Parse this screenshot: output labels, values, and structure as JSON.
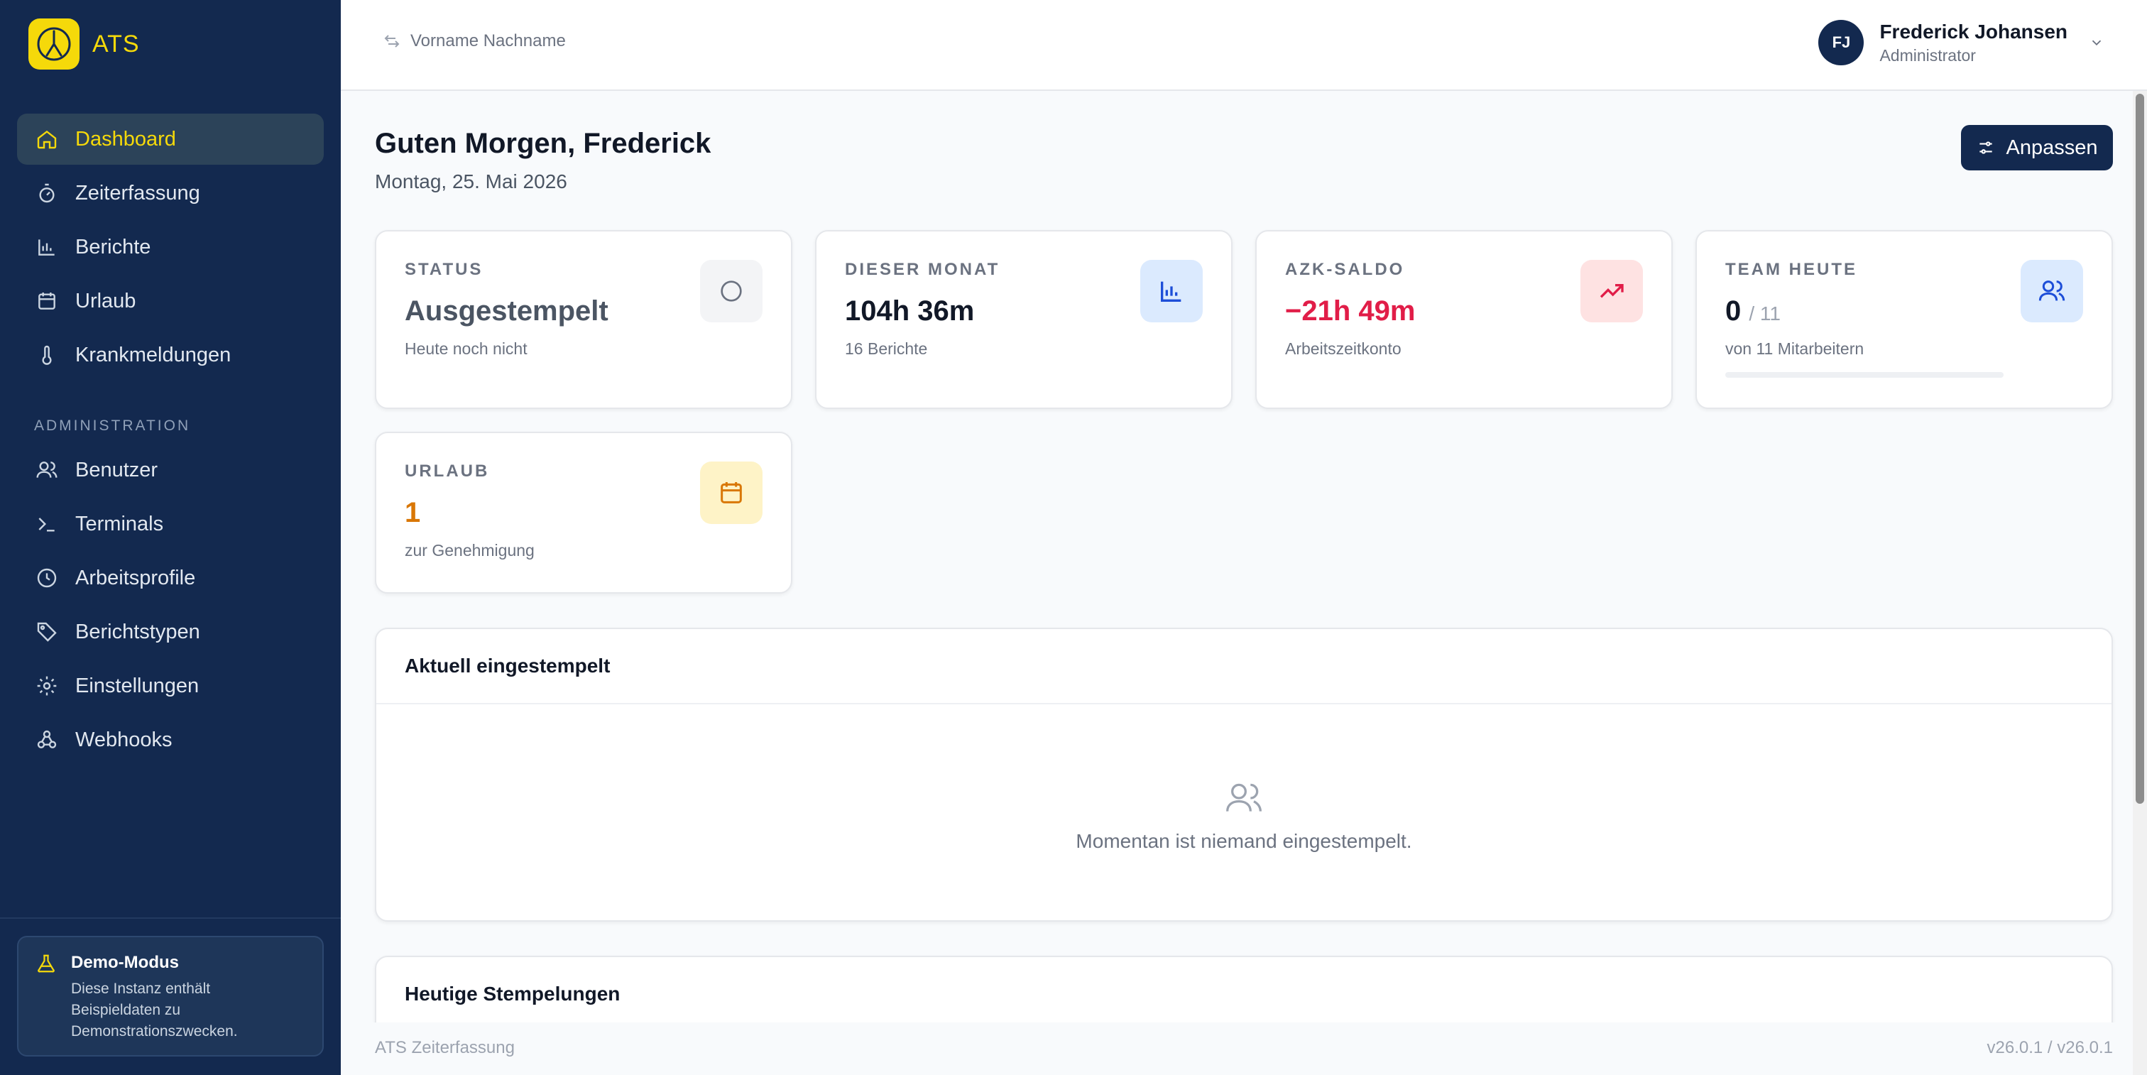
{
  "brand": {
    "name": "ATS"
  },
  "sidebar": {
    "nav": [
      {
        "label": "Dashboard",
        "icon": "home-icon"
      },
      {
        "label": "Zeiterfassung",
        "icon": "stopwatch-icon"
      },
      {
        "label": "Berichte",
        "icon": "bar-chart-icon"
      },
      {
        "label": "Urlaub",
        "icon": "calendar-icon"
      },
      {
        "label": "Krankmeldungen",
        "icon": "thermometer-icon"
      }
    ],
    "admin_label": "ADMINISTRATION",
    "admin": [
      {
        "label": "Benutzer",
        "icon": "users-icon"
      },
      {
        "label": "Terminals",
        "icon": "terminal-icon"
      },
      {
        "label": "Arbeitsprofile",
        "icon": "clock-icon"
      },
      {
        "label": "Berichtstypen",
        "icon": "tag-icon"
      },
      {
        "label": "Einstellungen",
        "icon": "gear-icon"
      },
      {
        "label": "Webhooks",
        "icon": "webhook-icon"
      }
    ],
    "demo": {
      "title": "Demo-Modus",
      "text": "Diese Instanz enthält Beispieldaten zu Demonstrationszwecken."
    }
  },
  "topbar": {
    "switch_placeholder": "Vorname Nachname",
    "user": {
      "initials": "FJ",
      "name": "Frederick Johansen",
      "role": "Administrator"
    }
  },
  "main": {
    "greeting": "Guten Morgen, Frederick",
    "date": "Montag, 25. Mai 2026",
    "customize_label": "Anpassen",
    "stats": {
      "status": {
        "label": "STATUS",
        "value": "Ausgestempelt",
        "sub": "Heute noch nicht"
      },
      "month": {
        "label": "DIESER MONAT",
        "value": "104h 36m",
        "sub": "16 Berichte"
      },
      "azk": {
        "label": "AZK-SALDO",
        "value": "−21h 49m",
        "sub": "Arbeitszeitkonto"
      },
      "team": {
        "label": "TEAM HEUTE",
        "value": "0",
        "total": "/ 11",
        "sub": "von 11 Mitarbeitern",
        "progress": 0
      },
      "vacation": {
        "label": "URLAUB",
        "value": "1",
        "sub": "zur Genehmigung"
      }
    },
    "clocked_in": {
      "title": "Aktuell eingestempelt",
      "empty": "Momentan ist niemand eingestempelt."
    },
    "today": {
      "title": "Heutige Stempelungen"
    }
  },
  "footer": {
    "left": "ATS Zeiterfassung",
    "right": "v26.0.1 / v26.0.1"
  },
  "colors": {
    "sidebar": "#13294f",
    "accent": "#f5d90a",
    "negative": "#e11d48",
    "warning": "#d97706"
  }
}
